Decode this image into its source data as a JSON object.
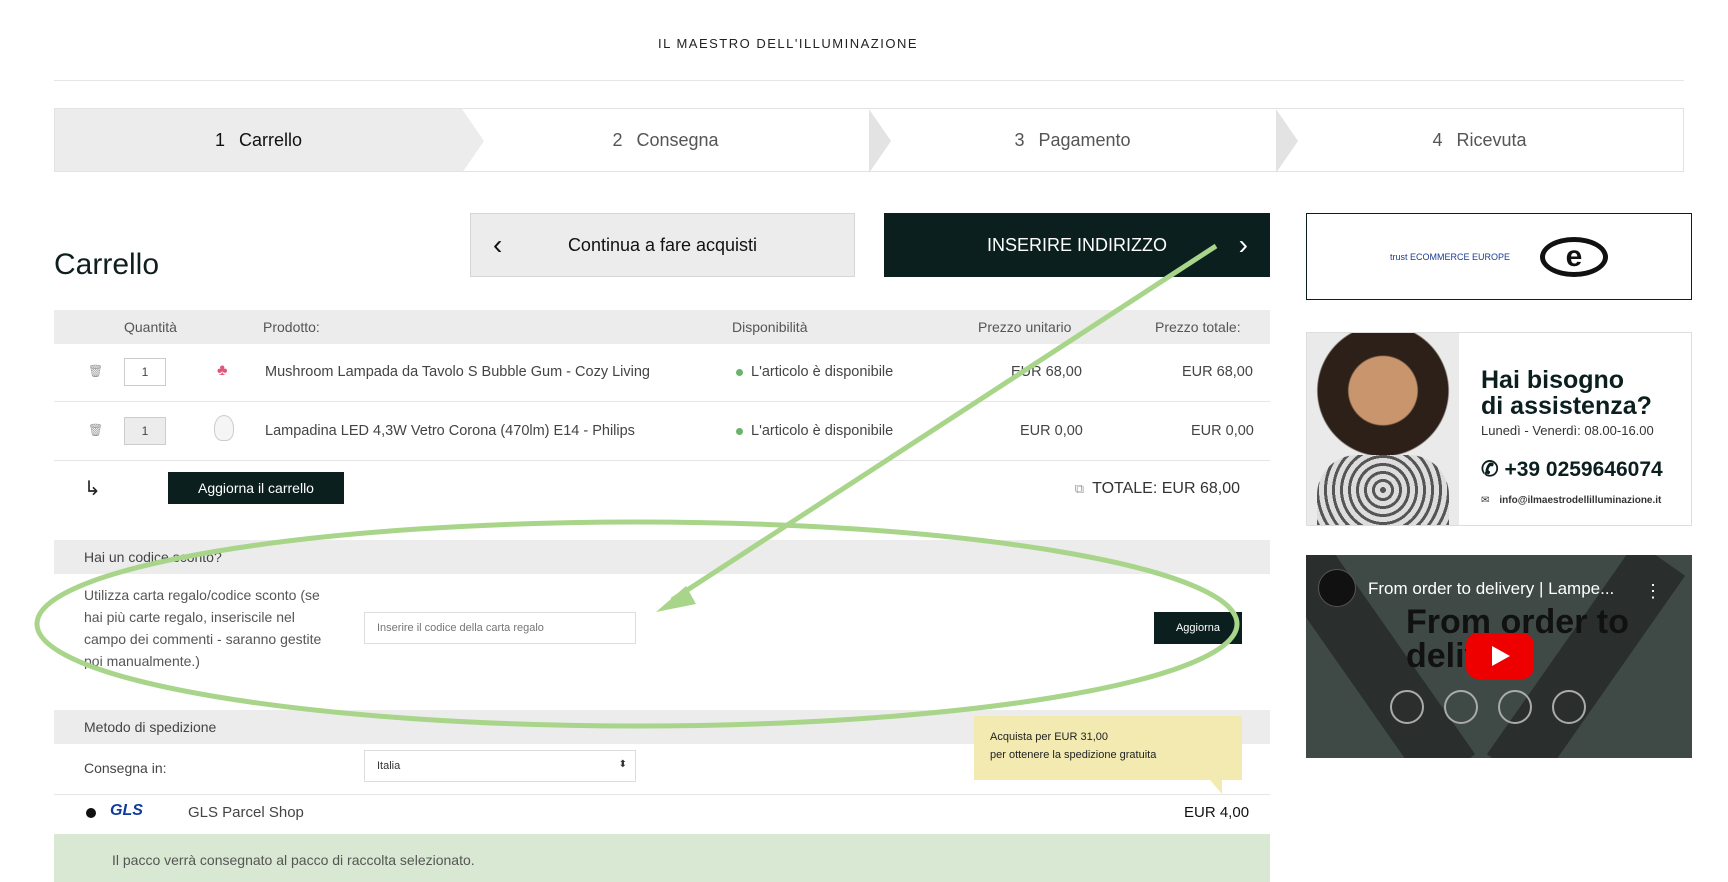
{
  "brand": {
    "logo": "IL MAESTRO DELL'ILLUMINAZIONE"
  },
  "steps": [
    {
      "num": "1",
      "label": "Carrello"
    },
    {
      "num": "2",
      "label": "Consegna"
    },
    {
      "num": "3",
      "label": "Pagamento"
    },
    {
      "num": "4",
      "label": "Ricevuta"
    }
  ],
  "page_title": "Carrello",
  "buttons": {
    "continue": "Continua a fare acquisti",
    "address": "INSERIRE INDIRIZZO",
    "update_cart": "Aggiorna il carrello",
    "apply": "Aggiorna"
  },
  "table": {
    "headers": {
      "qty": "Quantità",
      "product": "Prodotto:",
      "availability": "Disponibilità",
      "unit": "Prezzo unitario",
      "total": "Prezzo totale:"
    },
    "rows": [
      {
        "qty": "1",
        "product": "Mushroom Lampada da Tavolo S Bubble Gum - Cozy Living",
        "availability": "L'articolo è disponibile",
        "unit": "EUR 68,00",
        "total": "EUR 68,00"
      },
      {
        "qty": "1",
        "product": "Lampadina LED 4,3W Vetro Corona (470lm) E14 - Philips",
        "availability": "L'articolo è disponibile",
        "unit": "EUR 0,00",
        "total": "EUR 0,00"
      }
    ]
  },
  "cart_total": "TOTALE: EUR 68,00",
  "discount": {
    "heading": "Hai un codice sconto?",
    "text": "Utilizza carta regalo/codice sconto (se hai più carte regalo, inseriscile nel campo dei commenti - saranno gestite poi manualmente.)",
    "placeholder": "Inserire il codice della carta regalo"
  },
  "shipping": {
    "heading": "Metodo di spedizione",
    "deliver_label": "Consegna in:",
    "country": "Italia",
    "tooltip_line1": "Acquista per EUR 31,00",
    "tooltip_line2": "per ottenere la spedizione gratuita",
    "carrier_logo": "GLS",
    "method": "GLS Parcel Shop",
    "price": "EUR 4,00",
    "note": "Il pacco verrà consegnato al pacco di raccolta selezionato."
  },
  "trust": {
    "label": "trust ECOMMERCE EUROPE"
  },
  "assist": {
    "title_line1": "Hai bisogno",
    "title_line2": "di assistenza?",
    "hours": "Lunedì -  Venerdì: 08.00-16.00",
    "phone": "+39 0259646074",
    "email": "info@ilmaestrodellilluminazione.it"
  },
  "video": {
    "title": "From order to delivery | Lampe...",
    "overlay_text": "From order to delivery"
  },
  "colors": {
    "dark": "#0c1f1f",
    "annotation": "#a8d58a",
    "available": "#6ab36a",
    "tooltip": "#f2eab1",
    "note_bg": "#d9e8d2"
  }
}
